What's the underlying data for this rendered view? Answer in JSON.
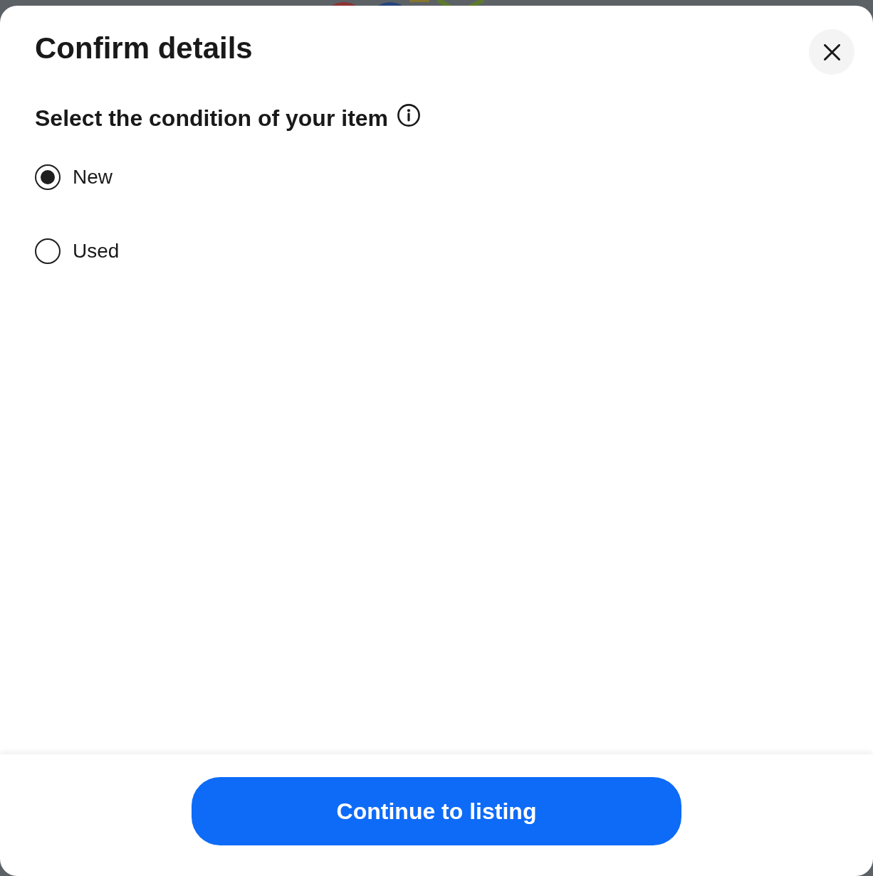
{
  "dialog": {
    "title": "Confirm details"
  },
  "condition": {
    "heading": "Select the condition of your item",
    "options": [
      {
        "label": "New",
        "selected": true
      },
      {
        "label": "Used",
        "selected": false
      }
    ]
  },
  "footer": {
    "button": "Continue to listing"
  }
}
